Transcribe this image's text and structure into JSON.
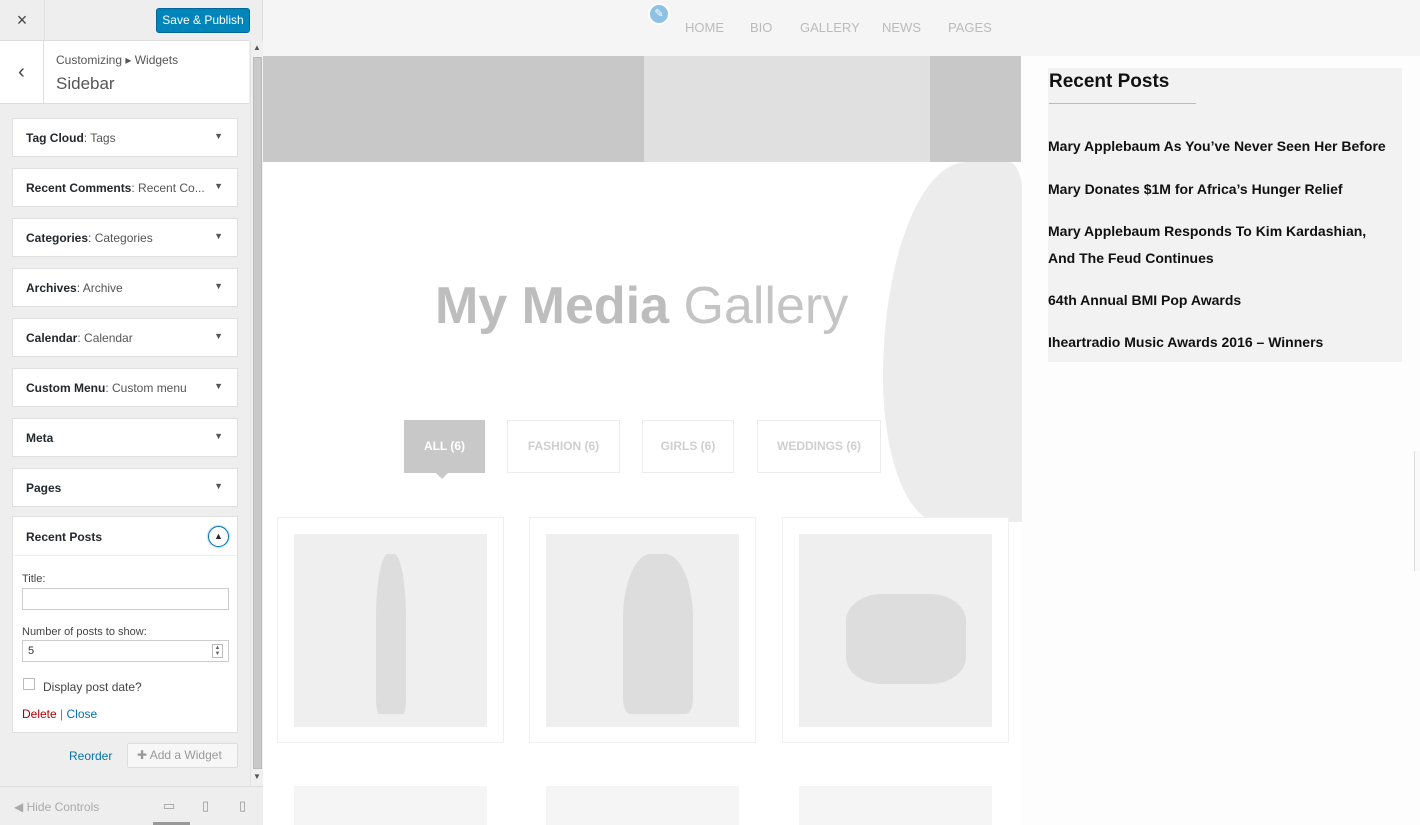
{
  "header": {
    "close_icon": "×",
    "publish": "Save & Publish"
  },
  "section": {
    "breadcrumb": "Customizing ▸ Widgets",
    "title": "Sidebar"
  },
  "widgets": [
    {
      "name": "Tag Cloud",
      "sub": ": Tags"
    },
    {
      "name": "Recent Comments",
      "sub": ": Recent Co..."
    },
    {
      "name": "Categories",
      "sub": ": Categories"
    },
    {
      "name": "Archives",
      "sub": ": Archive"
    },
    {
      "name": "Calendar",
      "sub": ": Calendar"
    },
    {
      "name": "Custom Menu",
      "sub": ": Custom menu"
    },
    {
      "name": "Meta",
      "sub": ""
    },
    {
      "name": "Pages",
      "sub": ""
    }
  ],
  "recent_posts_widget": {
    "name": "Recent Posts",
    "title_label": "Title:",
    "title_value": "",
    "count_label": "Number of posts to show:",
    "count_value": "5",
    "date_label": "Display post date?",
    "delete": "Delete",
    "separator": "|",
    "close": "Close"
  },
  "actions": {
    "reorder": "Reorder",
    "add": "Add a Widget"
  },
  "footer": {
    "hide": "Hide Controls"
  },
  "preview": {
    "nav": [
      "HOME",
      "BIO",
      "GALLERY",
      "NEWS",
      "PAGES"
    ],
    "gallery_title_bold": "My Media",
    "gallery_title_light": "Gallery",
    "filters": [
      "ALL (6)",
      "FASHION (6)",
      "GIRLS (6)",
      "WEDDINGS (6)"
    ],
    "sidebar_title": "Recent Posts",
    "posts": [
      "Mary Applebaum As You’ve Never Seen Her Before",
      "Mary Donates $1M for Africa’s Hunger Relief",
      "Mary Applebaum Responds To Kim Kardashian, And The Feud Continues",
      "64th Annual BMI Pop Awards",
      "Iheartradio Music Awards 2016 – Winners"
    ]
  },
  "colors": {
    "accent": "#0085ba",
    "link": "#0073aa",
    "delete": "#a00"
  }
}
